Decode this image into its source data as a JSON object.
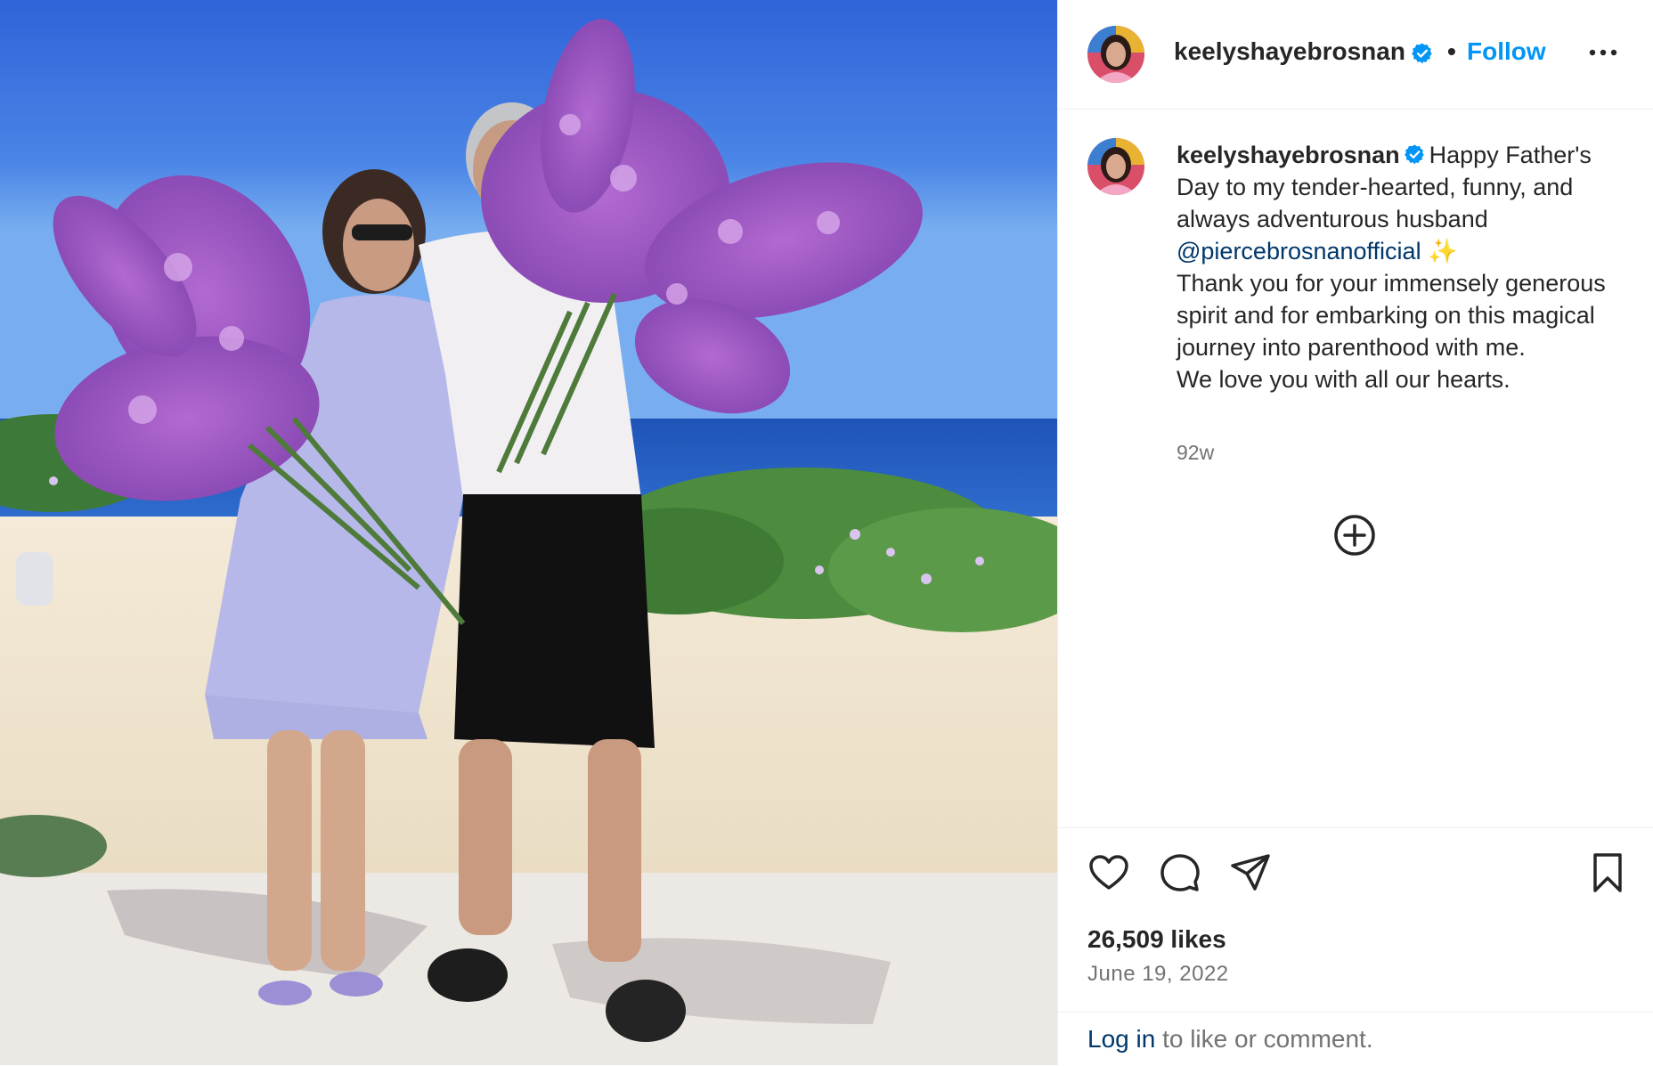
{
  "post": {
    "username": "keelyshayebrosnan",
    "separator": "•",
    "follow_label": "Follow",
    "more_icon": "more-horizontal-icon",
    "verified_icon": "verified-badge-icon",
    "photo_description_icon": "post-photo"
  },
  "caption": {
    "username": "keelyshayebrosnan",
    "text_before_mention": "Happy Father's Day to my tender-hearted, funny, and always adventurous husband ",
    "mention": "@piercebrosnanofficial",
    "sparkle": " ✨",
    "line_2": "Thank you for your immensely generous spirit and for embarking on this magical journey into parenthood with me.",
    "line_3": "We love you with all our hearts.",
    "age": "92w",
    "load_more_icon": "plus-circle-icon"
  },
  "actions": {
    "like_icon": "heart-icon",
    "comment_icon": "comment-icon",
    "share_icon": "send-icon",
    "save_icon": "bookmark-icon",
    "likes_count": "26,509 likes",
    "date": "June 19, 2022"
  },
  "footer": {
    "login_label": "Log in",
    "rest": " to like or comment."
  },
  "colors": {
    "accent": "#0095f6",
    "link": "#00376b",
    "muted": "#737373",
    "text": "#262626",
    "border": "#efefef"
  }
}
